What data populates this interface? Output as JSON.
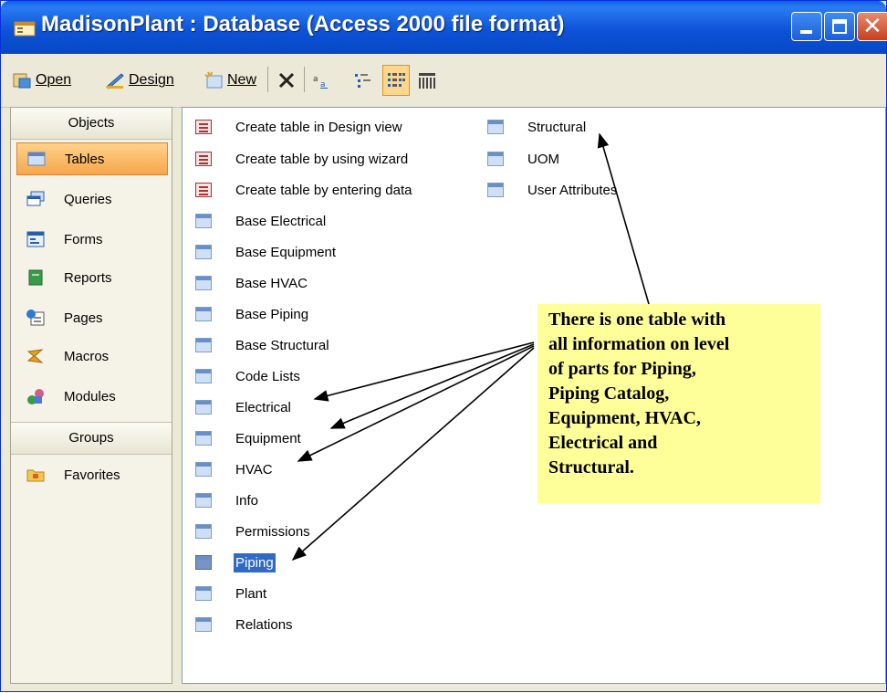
{
  "window": {
    "title": "MadisonPlant : Database (Access 2000 file format)",
    "controls": {
      "minimize": "minimize",
      "maximize": "maximize",
      "close": "✕"
    }
  },
  "toolbar": {
    "open_label": "Open",
    "design_label": "Design",
    "new_label": "New"
  },
  "objects_panel": {
    "header": "Objects",
    "items": [
      {
        "label": "Tables",
        "icon": "table-icon"
      },
      {
        "label": "Queries",
        "icon": "query-icon"
      },
      {
        "label": "Forms",
        "icon": "form-icon"
      },
      {
        "label": "Reports",
        "icon": "report-icon"
      },
      {
        "label": "Pages",
        "icon": "page-icon"
      },
      {
        "label": "Macros",
        "icon": "macro-icon"
      },
      {
        "label": "Modules",
        "icon": "module-icon"
      }
    ],
    "groups_header": "Groups",
    "groups": [
      {
        "label": "Favorites",
        "icon": "folder-icon"
      }
    ]
  },
  "list": {
    "col1": [
      "Create table in Design view",
      "Create table by using wizard",
      "Create table by entering data",
      "Base Electrical",
      "Base Equipment",
      "Base HVAC",
      "Base Piping",
      "Base Structural",
      "Code Lists",
      "Electrical",
      "Equipment",
      "HVAC",
      "Info",
      "Permissions",
      "Piping",
      "Plant",
      "Relations"
    ],
    "col2": [
      "Structural",
      "UOM",
      "User Attributes"
    ],
    "selected": "Piping"
  },
  "callout": {
    "lines": [
      "There is one table with",
      "all information on level",
      "of parts for Piping,",
      "Piping Catalog,",
      "Equipment, HVAC,",
      "Electrical and",
      "Structural."
    ],
    "background": "#ffff99"
  },
  "colors": {
    "titlebar": "#0d53d8",
    "selection": "#316ac5",
    "active_object": "#f6a64a"
  }
}
